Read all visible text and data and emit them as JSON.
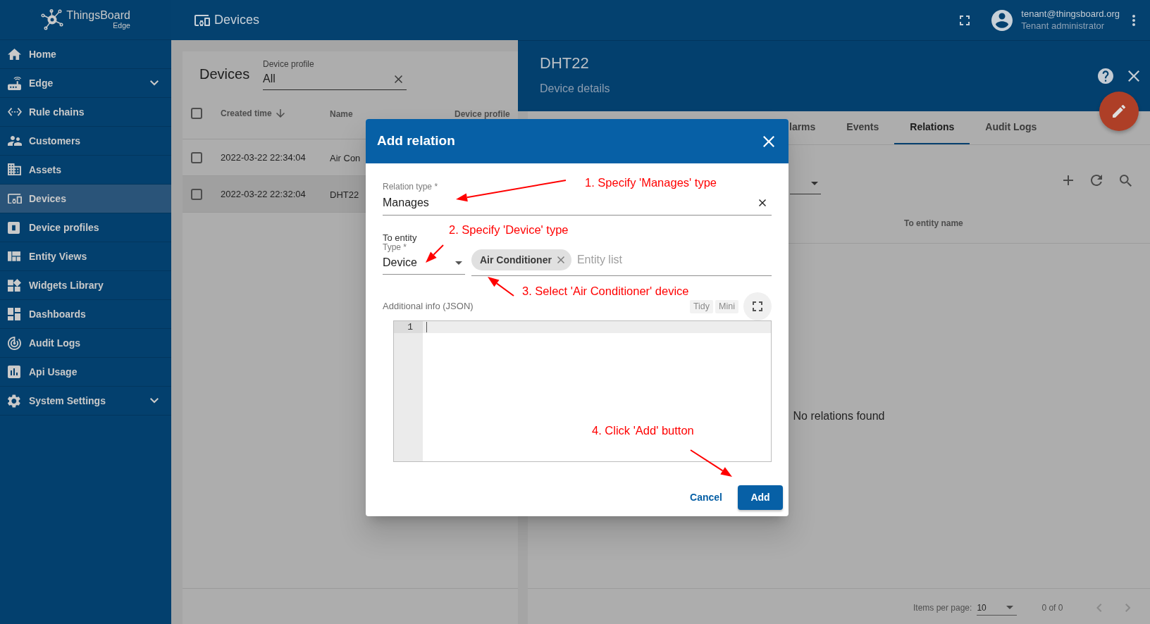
{
  "app": {
    "logo_title": "ThingsBoard",
    "logo_subtitle": "Edge"
  },
  "sidebar": {
    "items": [
      {
        "label": "Home",
        "kind": "link",
        "selected": false
      },
      {
        "label": "Edge",
        "kind": "group",
        "selected": false,
        "expanded": false
      },
      {
        "label": "Rule chains",
        "kind": "link",
        "selected": false
      },
      {
        "label": "Customers",
        "kind": "link",
        "selected": false
      },
      {
        "label": "Assets",
        "kind": "link",
        "selected": false
      },
      {
        "label": "Devices",
        "kind": "link",
        "selected": true
      },
      {
        "label": "Device profiles",
        "kind": "link",
        "selected": false
      },
      {
        "label": "Entity Views",
        "kind": "link",
        "selected": false
      },
      {
        "label": "Widgets Library",
        "kind": "link",
        "selected": false
      },
      {
        "label": "Dashboards",
        "kind": "link",
        "selected": false
      },
      {
        "label": "Audit Logs",
        "kind": "link",
        "selected": false
      },
      {
        "label": "Api Usage",
        "kind": "link",
        "selected": false
      },
      {
        "label": "System Settings",
        "kind": "group",
        "selected": false,
        "expanded": false
      }
    ]
  },
  "topbar": {
    "title": "Devices",
    "user": {
      "email": "tenant@thingsboard.org",
      "role": "Tenant administrator"
    }
  },
  "devices_list": {
    "title": "Devices",
    "filter": {
      "label": "Device profile",
      "value": "All"
    },
    "header_checked": false,
    "columns": [
      {
        "label": "Created time",
        "sorted": true
      },
      {
        "label": "Name",
        "sorted": false
      },
      {
        "label": "Device profile",
        "sorted": false
      }
    ],
    "rows": [
      {
        "cells": [
          "2022-03-22 22:34:04",
          "Air Con"
        ],
        "checked": false,
        "selected": false
      },
      {
        "cells": [
          "2022-03-22 22:32:04",
          "DHT22"
        ],
        "checked": false,
        "selected": true
      }
    ]
  },
  "details": {
    "title": "DHT22",
    "subtitle": "Device details",
    "tabs": [
      {
        "label": "larms",
        "selected": false
      },
      {
        "label": "Events",
        "selected": false
      },
      {
        "label": "Relations",
        "selected": true
      },
      {
        "label": "Audit Logs",
        "selected": false
      }
    ],
    "columns": [
      {
        "label": "To entity name"
      }
    ],
    "empty_text": "No relations found",
    "paginator": {
      "label": "Items per page:",
      "page_size": "10",
      "range": "0 of 0"
    }
  },
  "dialog": {
    "title": "Add relation",
    "relation_type": {
      "label": "Relation type *",
      "value": "Manages"
    },
    "to_entity": {
      "heading": "To entity",
      "type": {
        "label": "Type *",
        "value": "Device"
      },
      "chips": [
        {
          "label": "Air Conditioner"
        }
      ],
      "placeholder": "Entity list"
    },
    "additional_info": {
      "label": "Additional info (JSON)",
      "buttons": [
        "Tidy",
        "Mini"
      ],
      "editor": {
        "line_numbers": [
          "1"
        ],
        "focused": true
      }
    },
    "actions": [
      {
        "label": "Cancel",
        "kind": "text"
      },
      {
        "label": "Add",
        "kind": "primary"
      }
    ]
  },
  "annotations": [
    {
      "text": "1. Specify 'Manages' type"
    },
    {
      "text": "2. Specify 'Device' type"
    },
    {
      "text": "3. Select 'Air Conditioner' device"
    },
    {
      "text": "4. Click 'Add' button"
    }
  ]
}
